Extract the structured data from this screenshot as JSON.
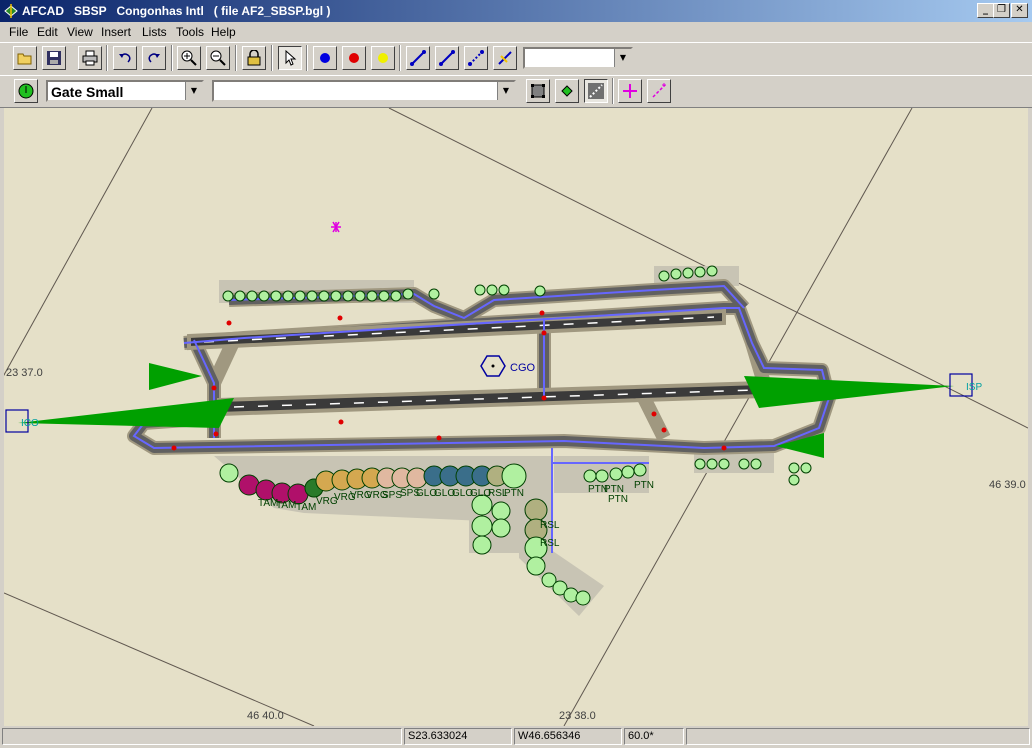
{
  "window": {
    "app_name": "AFCAD",
    "title": "AFCAD   SBSP   Congonhas Intl   ( file AF2_SBSP.bgl )",
    "min_glyph": "_",
    "restore_glyph": "❐",
    "close_glyph": "✕"
  },
  "menu": [
    "File",
    "Edit",
    "View",
    "Insert",
    "Lists",
    "Tools",
    "Help"
  ],
  "toolbar1": {
    "icons": [
      "open-icon",
      "save-icon",
      "print-icon",
      "undo-icon",
      "redo-icon",
      "zoom-in-icon",
      "zoom-out-icon",
      "lock-icon",
      "select-arrow-icon",
      "blue-node-icon",
      "red-node-icon",
      "yellow-node-icon",
      "taxi-link-icon",
      "taxi-link-icon",
      "taxi-link-dotted-icon",
      "taxi-link-hold-icon"
    ],
    "combo_value": ""
  },
  "toolbar2": {
    "parking_type": "Gate Small",
    "combo2_value": ""
  },
  "map": {
    "lat_label_left": "23 37.0",
    "lon_label_right": "46 39.0",
    "lon_label_bottom": "46 40.0",
    "lat_label_bottom": "23 38.0",
    "vor_label": "CGO",
    "ils_left": "ICO",
    "ils_right": "ISP",
    "gate_labels": [
      "TAM",
      "TAM",
      "TAM",
      "VRG",
      "VRG",
      "VRG",
      "VRG",
      "SPS",
      "SPS",
      "GLO",
      "GLO",
      "GLO",
      "GLO",
      "RSL",
      "RSL",
      "RSL",
      "PTN",
      "PTN",
      "PTN",
      "PTN",
      "PTN"
    ],
    "colors": {
      "canvas": "#e5e0c8",
      "apron": "#c8c4b4",
      "runway": "#808080",
      "taxi_link": "#6666ff",
      "ils_arrow": "#00a000",
      "gate_green": "#b0f0a0",
      "gate_tam": "#b0106a",
      "gate_vrg": "#d4a850",
      "gate_gol": "#3a6e8a"
    }
  },
  "status": {
    "panel1": "",
    "lat": "S23.633024",
    "lon": "W46.656346",
    "heading": "60.0*"
  }
}
